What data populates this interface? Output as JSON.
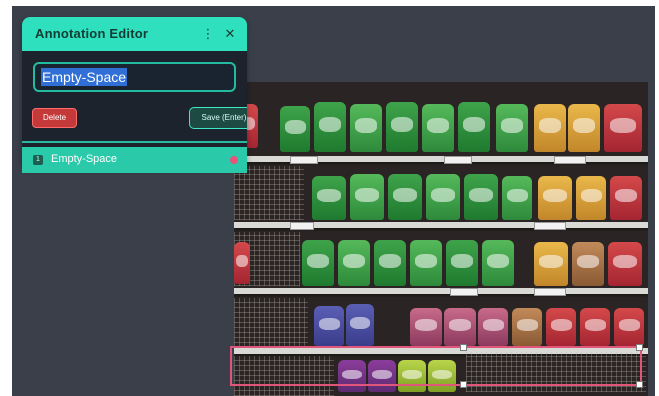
{
  "editor": {
    "title": "Annotation Editor",
    "menu_icon": "kebab-menu-icon",
    "close_icon": "close-icon",
    "name_value": "Empty-Space",
    "delete_label": "Delete",
    "save_label": "Save (Enter)"
  },
  "annotations": [
    {
      "index": "1",
      "label": "Empty-Space",
      "color": "#e5547a"
    }
  ],
  "colors": {
    "accent": "#2ee0bd",
    "panel_bg": "#1c232c",
    "delete": "#c43a3a",
    "bbox": "#e0557a"
  }
}
